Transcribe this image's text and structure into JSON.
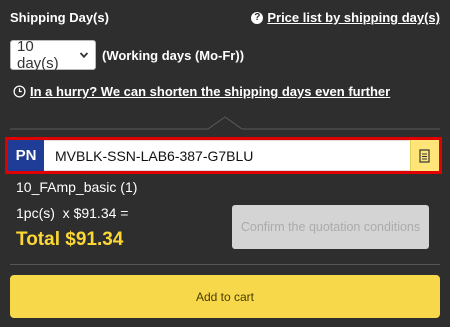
{
  "header": {
    "shipping_label": "Shipping Day(s)",
    "price_list_link": "Price list by shipping day(s)"
  },
  "shipping": {
    "selected_option": "10 day(s)",
    "note": "(Working days (Mo-Fr))",
    "hurry_link": "In a hurry? We can shorten the shipping days even further"
  },
  "part_number": {
    "tag": "PN",
    "code": "MVBLK-SSN-LAB6-387-G7BLU"
  },
  "product": {
    "model": "10_FAmp_basic (1)",
    "quantity_line": "1pc(s)  x $91.34 =",
    "total": "Total $91.34"
  },
  "buttons": {
    "confirm": "Confirm the quotation conditions",
    "add_to_cart": "Add to cart"
  },
  "colors": {
    "background": "#2e2e2e",
    "pn_tag": "#1f3c97",
    "highlight_border": "#e00000",
    "total": "#fdd835",
    "add_to_cart": "#f7d84a"
  },
  "icons": [
    "question-icon",
    "chevron-down-icon",
    "clock-icon",
    "copy-icon"
  ]
}
